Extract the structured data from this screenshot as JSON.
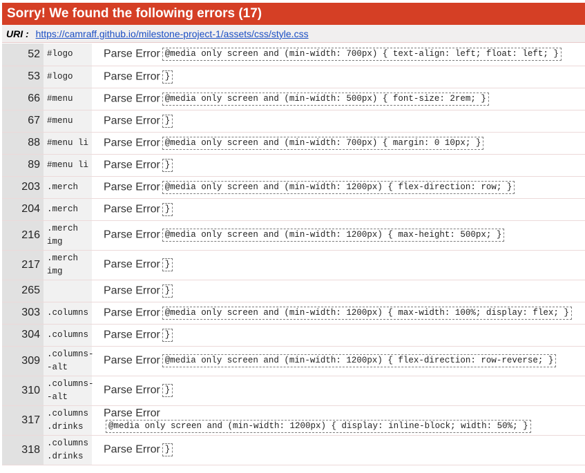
{
  "header": {
    "title": "Sorry! We found the following errors (17)"
  },
  "uri": {
    "label": "URI :",
    "url": "https://camraff.github.io/milestone-project-1/assets/css/style.css"
  },
  "errors": [
    {
      "line": "52",
      "context": "#logo",
      "message": "Parse Error",
      "code": "@media only screen and (min-width: 700px) { text-align: left; float: left; }"
    },
    {
      "line": "53",
      "context": "#logo",
      "message": "Parse Error",
      "code": "}"
    },
    {
      "line": "66",
      "context": "#menu",
      "message": "Parse Error",
      "code": "@media only screen and (min-width: 500px) { font-size: 2rem; }"
    },
    {
      "line": "67",
      "context": "#menu",
      "message": "Parse Error",
      "code": "}"
    },
    {
      "line": "88",
      "context": "#menu li",
      "message": "Parse Error",
      "code": "@media only screen and (min-width: 700px) { margin: 0 10px; }"
    },
    {
      "line": "89",
      "context": "#menu li",
      "message": "Parse Error",
      "code": "}"
    },
    {
      "line": "203",
      "context": ".merch",
      "message": "Parse Error",
      "code": "@media only screen and (min-width: 1200px) { flex-direction: row; }"
    },
    {
      "line": "204",
      "context": ".merch",
      "message": "Parse Error",
      "code": "}"
    },
    {
      "line": "216",
      "context": ".merch\nimg",
      "message": "Parse Error",
      "code": "@media only screen and (min-width: 1200px) { max-height: 500px; }"
    },
    {
      "line": "217",
      "context": ".merch\nimg",
      "message": "Parse Error",
      "code": "}"
    },
    {
      "line": "265",
      "context": "",
      "message": "Parse Error",
      "code": "}"
    },
    {
      "line": "303",
      "context": ".columns",
      "message": "Parse Error",
      "code": "@media only screen and (min-width: 1200px) { max-width: 100%; display: flex; }"
    },
    {
      "line": "304",
      "context": ".columns",
      "message": "Parse Error",
      "code": "}"
    },
    {
      "line": "309",
      "context": ".columns-\n-alt",
      "message": "Parse Error",
      "code": "@media only screen and (min-width: 1200px) { flex-direction: row-reverse; }"
    },
    {
      "line": "310",
      "context": ".columns-\n-alt",
      "message": "Parse Error",
      "code": "}"
    },
    {
      "line": "317",
      "context": ".columns\n.drinks",
      "message": "Parse Error",
      "code": "@media only screen and (min-width: 1200px) { display: inline-block; width: 50%; }"
    },
    {
      "line": "318",
      "context": ".columns\n.drinks",
      "message": "Parse Error",
      "code": "}"
    }
  ]
}
